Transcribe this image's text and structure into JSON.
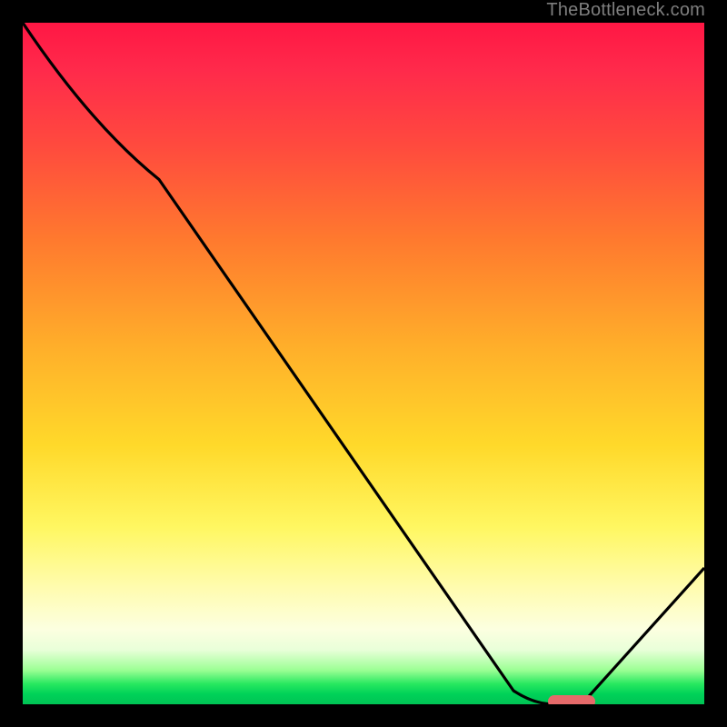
{
  "watermark": "TheBottleneck.com",
  "colors": {
    "curve": "#000000",
    "marker": "#e66a6a",
    "gradient_top": "#ff1744",
    "gradient_mid": "#ffd92a",
    "gradient_bottom": "#00c455"
  },
  "chart_data": {
    "type": "line",
    "title": "",
    "xlabel": "",
    "ylabel": "",
    "xlim": [
      0,
      100
    ],
    "ylim": [
      0,
      100
    ],
    "series": [
      {
        "name": "bottleneck-curve",
        "x": [
          0,
          20,
          72,
          78,
          82,
          100
        ],
        "y": [
          100,
          77,
          2,
          0,
          0,
          20
        ]
      }
    ],
    "optimal_zone": {
      "x_start": 77,
      "x_end": 84,
      "y": 0
    },
    "notes": "Background is a vertical red→yellow→green gradient (bottleneck severity). The black curve descends from top-left, flattens at y≈0 around x≈77–84 (optimal), then rises again. A small pink rounded bar marks the optimal flat region."
  }
}
